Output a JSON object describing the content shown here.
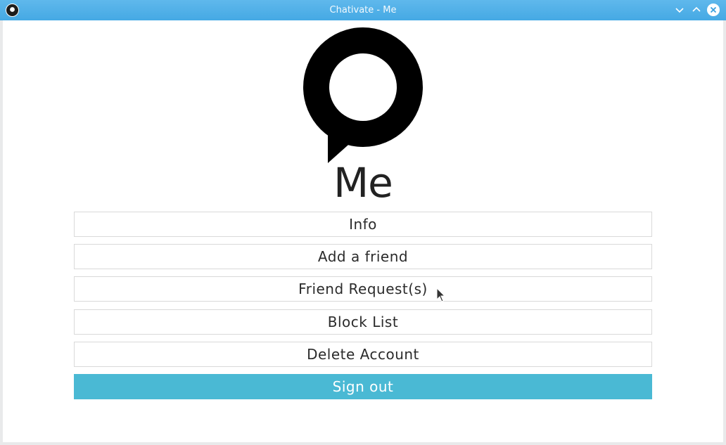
{
  "window": {
    "title": "Chativate - Me",
    "app_icon": "chativate-logo-icon",
    "controls": {
      "minimize_icon": "chevron-down-icon",
      "maximize_icon": "chevron-up-icon",
      "close_icon": "close-icon"
    }
  },
  "page": {
    "logo_icon": "chat-bubble-logo-icon",
    "title": "Me"
  },
  "menu": {
    "info": "Info",
    "add_friend": "Add a friend",
    "friend_requests": "Friend Request(s)",
    "block_list": "Block List",
    "delete_account": "Delete Account",
    "sign_out": "Sign out"
  },
  "back": {
    "label": "<"
  },
  "colors": {
    "titlebar": "#45a9e4",
    "accent": "#4ab9d4",
    "text": "#2b2b2b",
    "button_border": "#d9d9d9"
  }
}
